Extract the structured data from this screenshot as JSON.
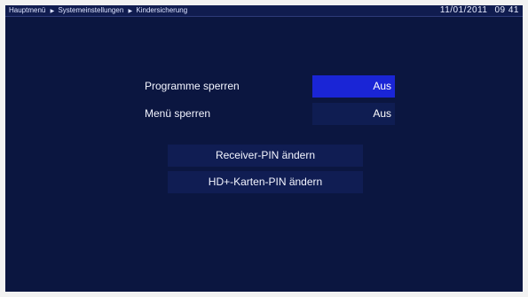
{
  "breadcrumb": {
    "items": [
      "Hauptmenü",
      "Systemeinstellungen",
      "Kindersicherung"
    ]
  },
  "clock": {
    "date": "11/01/2011",
    "time": "09 41"
  },
  "settings": [
    {
      "label": "Programme sperren",
      "value": "Aus",
      "selected": true
    },
    {
      "label": "Menü sperren",
      "value": "Aus",
      "selected": false
    }
  ],
  "buttons": {
    "receiver_pin": "Receiver-PIN ändern",
    "card_pin": "HD+-Karten-PIN ändern"
  },
  "colors": {
    "background": "#0b1640",
    "highlight": "#1a25d6",
    "field": "#0f1d52"
  }
}
